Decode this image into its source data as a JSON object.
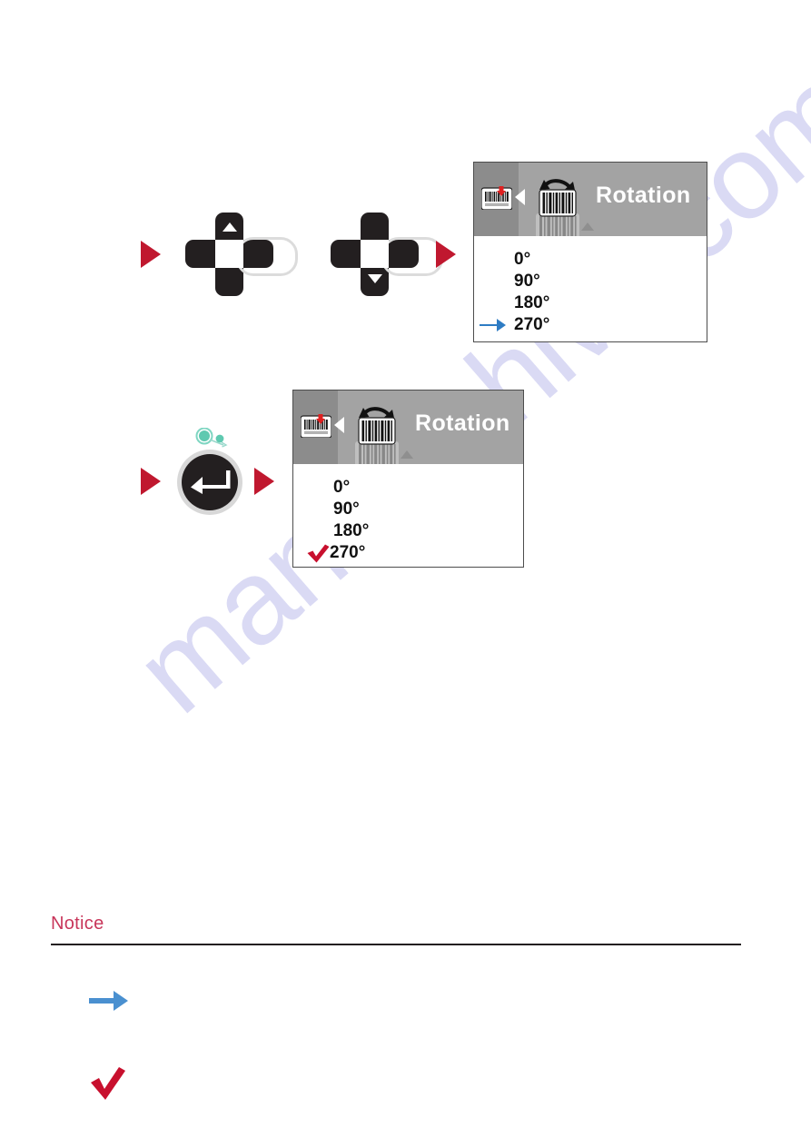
{
  "watermark": {
    "text": "manualshive.com"
  },
  "steps": [
    {
      "id": "step-navigate",
      "controls": [
        {
          "type": "dpad",
          "direction": "up",
          "name": "dpad-up"
        },
        {
          "type": "dpad",
          "direction": "down",
          "name": "dpad-down"
        }
      ],
      "screen": {
        "header": {
          "title": "Rotation",
          "prev_icon": "barcode-marker-icon",
          "current_icon": "barcode-rotation-icon",
          "ghost_icon": "barcode-icon-faded"
        },
        "options": [
          {
            "label": "0°",
            "marker": "none"
          },
          {
            "label": "90°",
            "marker": "none"
          },
          {
            "label": "180°",
            "marker": "none"
          },
          {
            "label": "270°",
            "marker": "arrow"
          }
        ]
      }
    },
    {
      "id": "step-confirm",
      "controls": [
        {
          "type": "enter",
          "name": "enter-button"
        }
      ],
      "screen": {
        "header": {
          "title": "Rotation",
          "prev_icon": "barcode-marker-icon",
          "current_icon": "barcode-rotation-icon",
          "ghost_icon": "barcode-icon-faded"
        },
        "options": [
          {
            "label": "0°",
            "marker": "none"
          },
          {
            "label": "90°",
            "marker": "none"
          },
          {
            "label": "180°",
            "marker": "none"
          },
          {
            "label": "270°",
            "marker": "check"
          }
        ]
      }
    }
  ],
  "notice": {
    "title": "Notice",
    "legend": [
      {
        "icon": "blue-arrow-icon",
        "text": ""
      },
      {
        "icon": "red-check-icon",
        "text": ""
      }
    ]
  },
  "colors": {
    "accent_red": "#C0182F",
    "check_red": "#C8102E",
    "notice_red": "#C8355A",
    "arrow_blue": "#4A90D0",
    "screen_header": "#A3A3A3",
    "screen_strip": "#8C8C8C",
    "control_dark": "#231F20",
    "teal": "#5FC9B0"
  }
}
